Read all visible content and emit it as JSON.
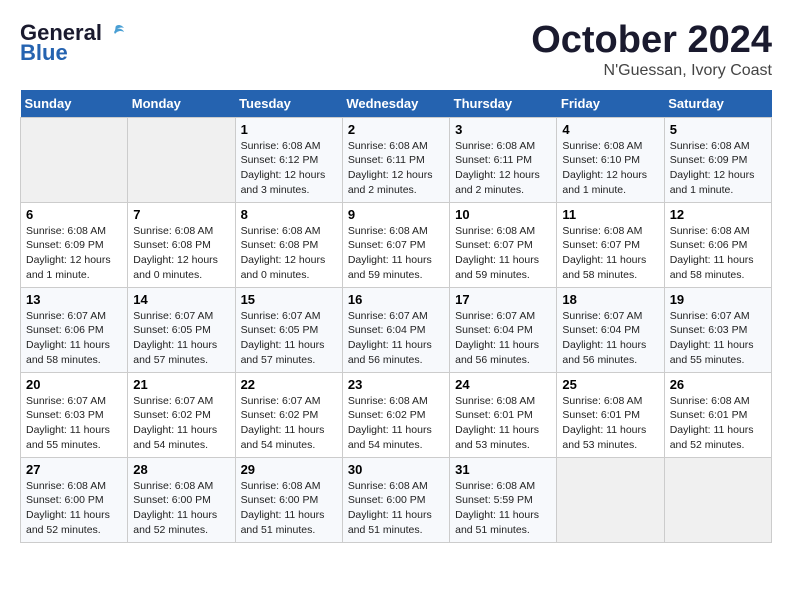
{
  "header": {
    "logo_line1": "General",
    "logo_line2": "Blue",
    "month": "October 2024",
    "location": "N'Guessan, Ivory Coast"
  },
  "weekdays": [
    "Sunday",
    "Monday",
    "Tuesday",
    "Wednesday",
    "Thursday",
    "Friday",
    "Saturday"
  ],
  "weeks": [
    [
      {
        "day": "",
        "info": ""
      },
      {
        "day": "",
        "info": ""
      },
      {
        "day": "1",
        "info": "Sunrise: 6:08 AM\nSunset: 6:12 PM\nDaylight: 12 hours\nand 3 minutes."
      },
      {
        "day": "2",
        "info": "Sunrise: 6:08 AM\nSunset: 6:11 PM\nDaylight: 12 hours\nand 2 minutes."
      },
      {
        "day": "3",
        "info": "Sunrise: 6:08 AM\nSunset: 6:11 PM\nDaylight: 12 hours\nand 2 minutes."
      },
      {
        "day": "4",
        "info": "Sunrise: 6:08 AM\nSunset: 6:10 PM\nDaylight: 12 hours\nand 1 minute."
      },
      {
        "day": "5",
        "info": "Sunrise: 6:08 AM\nSunset: 6:09 PM\nDaylight: 12 hours\nand 1 minute."
      }
    ],
    [
      {
        "day": "6",
        "info": "Sunrise: 6:08 AM\nSunset: 6:09 PM\nDaylight: 12 hours\nand 1 minute."
      },
      {
        "day": "7",
        "info": "Sunrise: 6:08 AM\nSunset: 6:08 PM\nDaylight: 12 hours\nand 0 minutes."
      },
      {
        "day": "8",
        "info": "Sunrise: 6:08 AM\nSunset: 6:08 PM\nDaylight: 12 hours\nand 0 minutes."
      },
      {
        "day": "9",
        "info": "Sunrise: 6:08 AM\nSunset: 6:07 PM\nDaylight: 11 hours\nand 59 minutes."
      },
      {
        "day": "10",
        "info": "Sunrise: 6:08 AM\nSunset: 6:07 PM\nDaylight: 11 hours\nand 59 minutes."
      },
      {
        "day": "11",
        "info": "Sunrise: 6:08 AM\nSunset: 6:07 PM\nDaylight: 11 hours\nand 58 minutes."
      },
      {
        "day": "12",
        "info": "Sunrise: 6:08 AM\nSunset: 6:06 PM\nDaylight: 11 hours\nand 58 minutes."
      }
    ],
    [
      {
        "day": "13",
        "info": "Sunrise: 6:07 AM\nSunset: 6:06 PM\nDaylight: 11 hours\nand 58 minutes."
      },
      {
        "day": "14",
        "info": "Sunrise: 6:07 AM\nSunset: 6:05 PM\nDaylight: 11 hours\nand 57 minutes."
      },
      {
        "day": "15",
        "info": "Sunrise: 6:07 AM\nSunset: 6:05 PM\nDaylight: 11 hours\nand 57 minutes."
      },
      {
        "day": "16",
        "info": "Sunrise: 6:07 AM\nSunset: 6:04 PM\nDaylight: 11 hours\nand 56 minutes."
      },
      {
        "day": "17",
        "info": "Sunrise: 6:07 AM\nSunset: 6:04 PM\nDaylight: 11 hours\nand 56 minutes."
      },
      {
        "day": "18",
        "info": "Sunrise: 6:07 AM\nSunset: 6:04 PM\nDaylight: 11 hours\nand 56 minutes."
      },
      {
        "day": "19",
        "info": "Sunrise: 6:07 AM\nSunset: 6:03 PM\nDaylight: 11 hours\nand 55 minutes."
      }
    ],
    [
      {
        "day": "20",
        "info": "Sunrise: 6:07 AM\nSunset: 6:03 PM\nDaylight: 11 hours\nand 55 minutes."
      },
      {
        "day": "21",
        "info": "Sunrise: 6:07 AM\nSunset: 6:02 PM\nDaylight: 11 hours\nand 54 minutes."
      },
      {
        "day": "22",
        "info": "Sunrise: 6:07 AM\nSunset: 6:02 PM\nDaylight: 11 hours\nand 54 minutes."
      },
      {
        "day": "23",
        "info": "Sunrise: 6:08 AM\nSunset: 6:02 PM\nDaylight: 11 hours\nand 54 minutes."
      },
      {
        "day": "24",
        "info": "Sunrise: 6:08 AM\nSunset: 6:01 PM\nDaylight: 11 hours\nand 53 minutes."
      },
      {
        "day": "25",
        "info": "Sunrise: 6:08 AM\nSunset: 6:01 PM\nDaylight: 11 hours\nand 53 minutes."
      },
      {
        "day": "26",
        "info": "Sunrise: 6:08 AM\nSunset: 6:01 PM\nDaylight: 11 hours\nand 52 minutes."
      }
    ],
    [
      {
        "day": "27",
        "info": "Sunrise: 6:08 AM\nSunset: 6:00 PM\nDaylight: 11 hours\nand 52 minutes."
      },
      {
        "day": "28",
        "info": "Sunrise: 6:08 AM\nSunset: 6:00 PM\nDaylight: 11 hours\nand 52 minutes."
      },
      {
        "day": "29",
        "info": "Sunrise: 6:08 AM\nSunset: 6:00 PM\nDaylight: 11 hours\nand 51 minutes."
      },
      {
        "day": "30",
        "info": "Sunrise: 6:08 AM\nSunset: 6:00 PM\nDaylight: 11 hours\nand 51 minutes."
      },
      {
        "day": "31",
        "info": "Sunrise: 6:08 AM\nSunset: 5:59 PM\nDaylight: 11 hours\nand 51 minutes."
      },
      {
        "day": "",
        "info": ""
      },
      {
        "day": "",
        "info": ""
      }
    ]
  ]
}
